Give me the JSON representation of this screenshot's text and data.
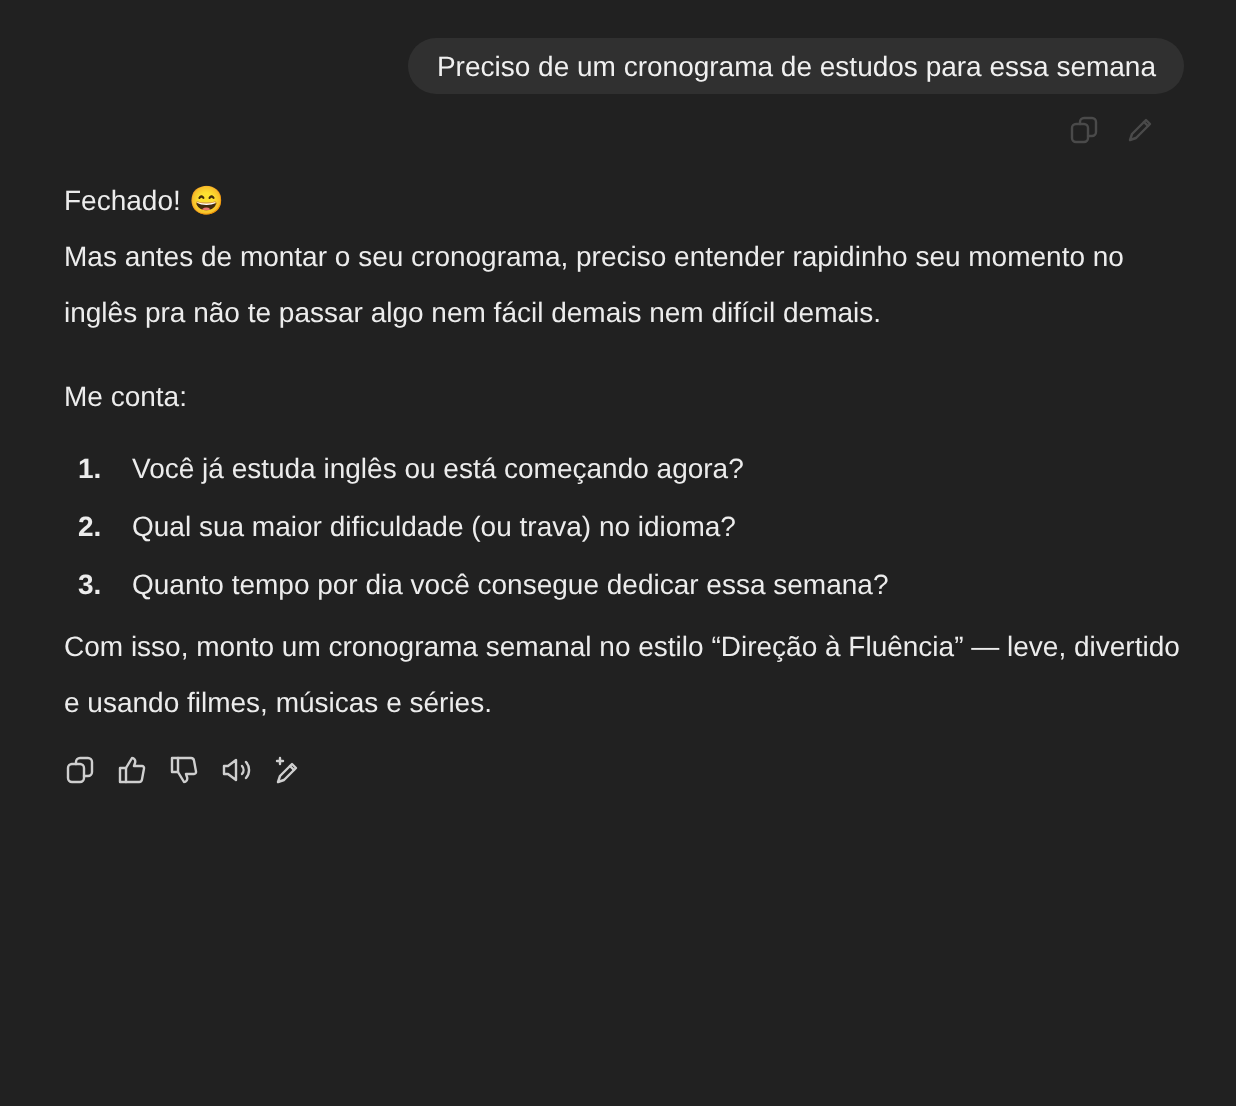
{
  "user_message": {
    "text": "Preciso de um cronograma de estudos para essa semana",
    "actions": [
      {
        "kind": "copy"
      },
      {
        "kind": "edit"
      }
    ]
  },
  "reply": {
    "greeting": "Fechado!",
    "emoji": "😄",
    "intro": "Mas antes de montar o seu cronograma, preciso entender rapidinho seu momento no inglês pra não te passar algo nem fácil demais nem difícil demais.",
    "lead": "Me conta:",
    "questions": [
      {
        "number": "1.",
        "text": "Você já estuda inglês ou está começando agora?"
      },
      {
        "number": "2.",
        "text": "Qual sua maior dificuldade (ou trava) no idioma?"
      },
      {
        "number": "3.",
        "text": "Quanto tempo por dia você consegue dedicar essa semana?"
      }
    ],
    "closing": "Com isso, monto um cronograma semanal no estilo “Direção à Fluência” — leve, divertido e usando filmes, músicas e séries.",
    "actions": [
      {
        "kind": "copy"
      },
      {
        "kind": "like"
      },
      {
        "kind": "dislike"
      },
      {
        "kind": "speak"
      },
      {
        "kind": "edit-sparkle"
      }
    ]
  }
}
